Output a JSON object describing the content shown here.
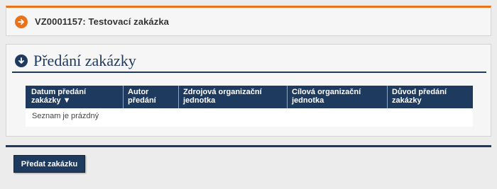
{
  "order": {
    "title": "VZ0001157: Testovací zakázka",
    "icon": "arrow-right-icon"
  },
  "section": {
    "title": "Předání zakázky",
    "icon": "arrow-down-icon",
    "table": {
      "columns": [
        {
          "line1": "Datum předání",
          "line2": "zakázky ▼"
        },
        {
          "line1": "Autor",
          "line2": "předání"
        },
        {
          "line1": "Zdrojová organizační",
          "line2": "jednotka"
        },
        {
          "line1": "Cílová organizační",
          "line2": "jednotka"
        },
        {
          "line1": "Důvod předání",
          "line2": "zakázky"
        }
      ],
      "empty_message": "Seznam je prázdný"
    }
  },
  "actions": {
    "handover_label": "Předat zakázku"
  },
  "colors": {
    "accent_orange": "#e8731b",
    "brand_navy": "#1f3a5f"
  }
}
